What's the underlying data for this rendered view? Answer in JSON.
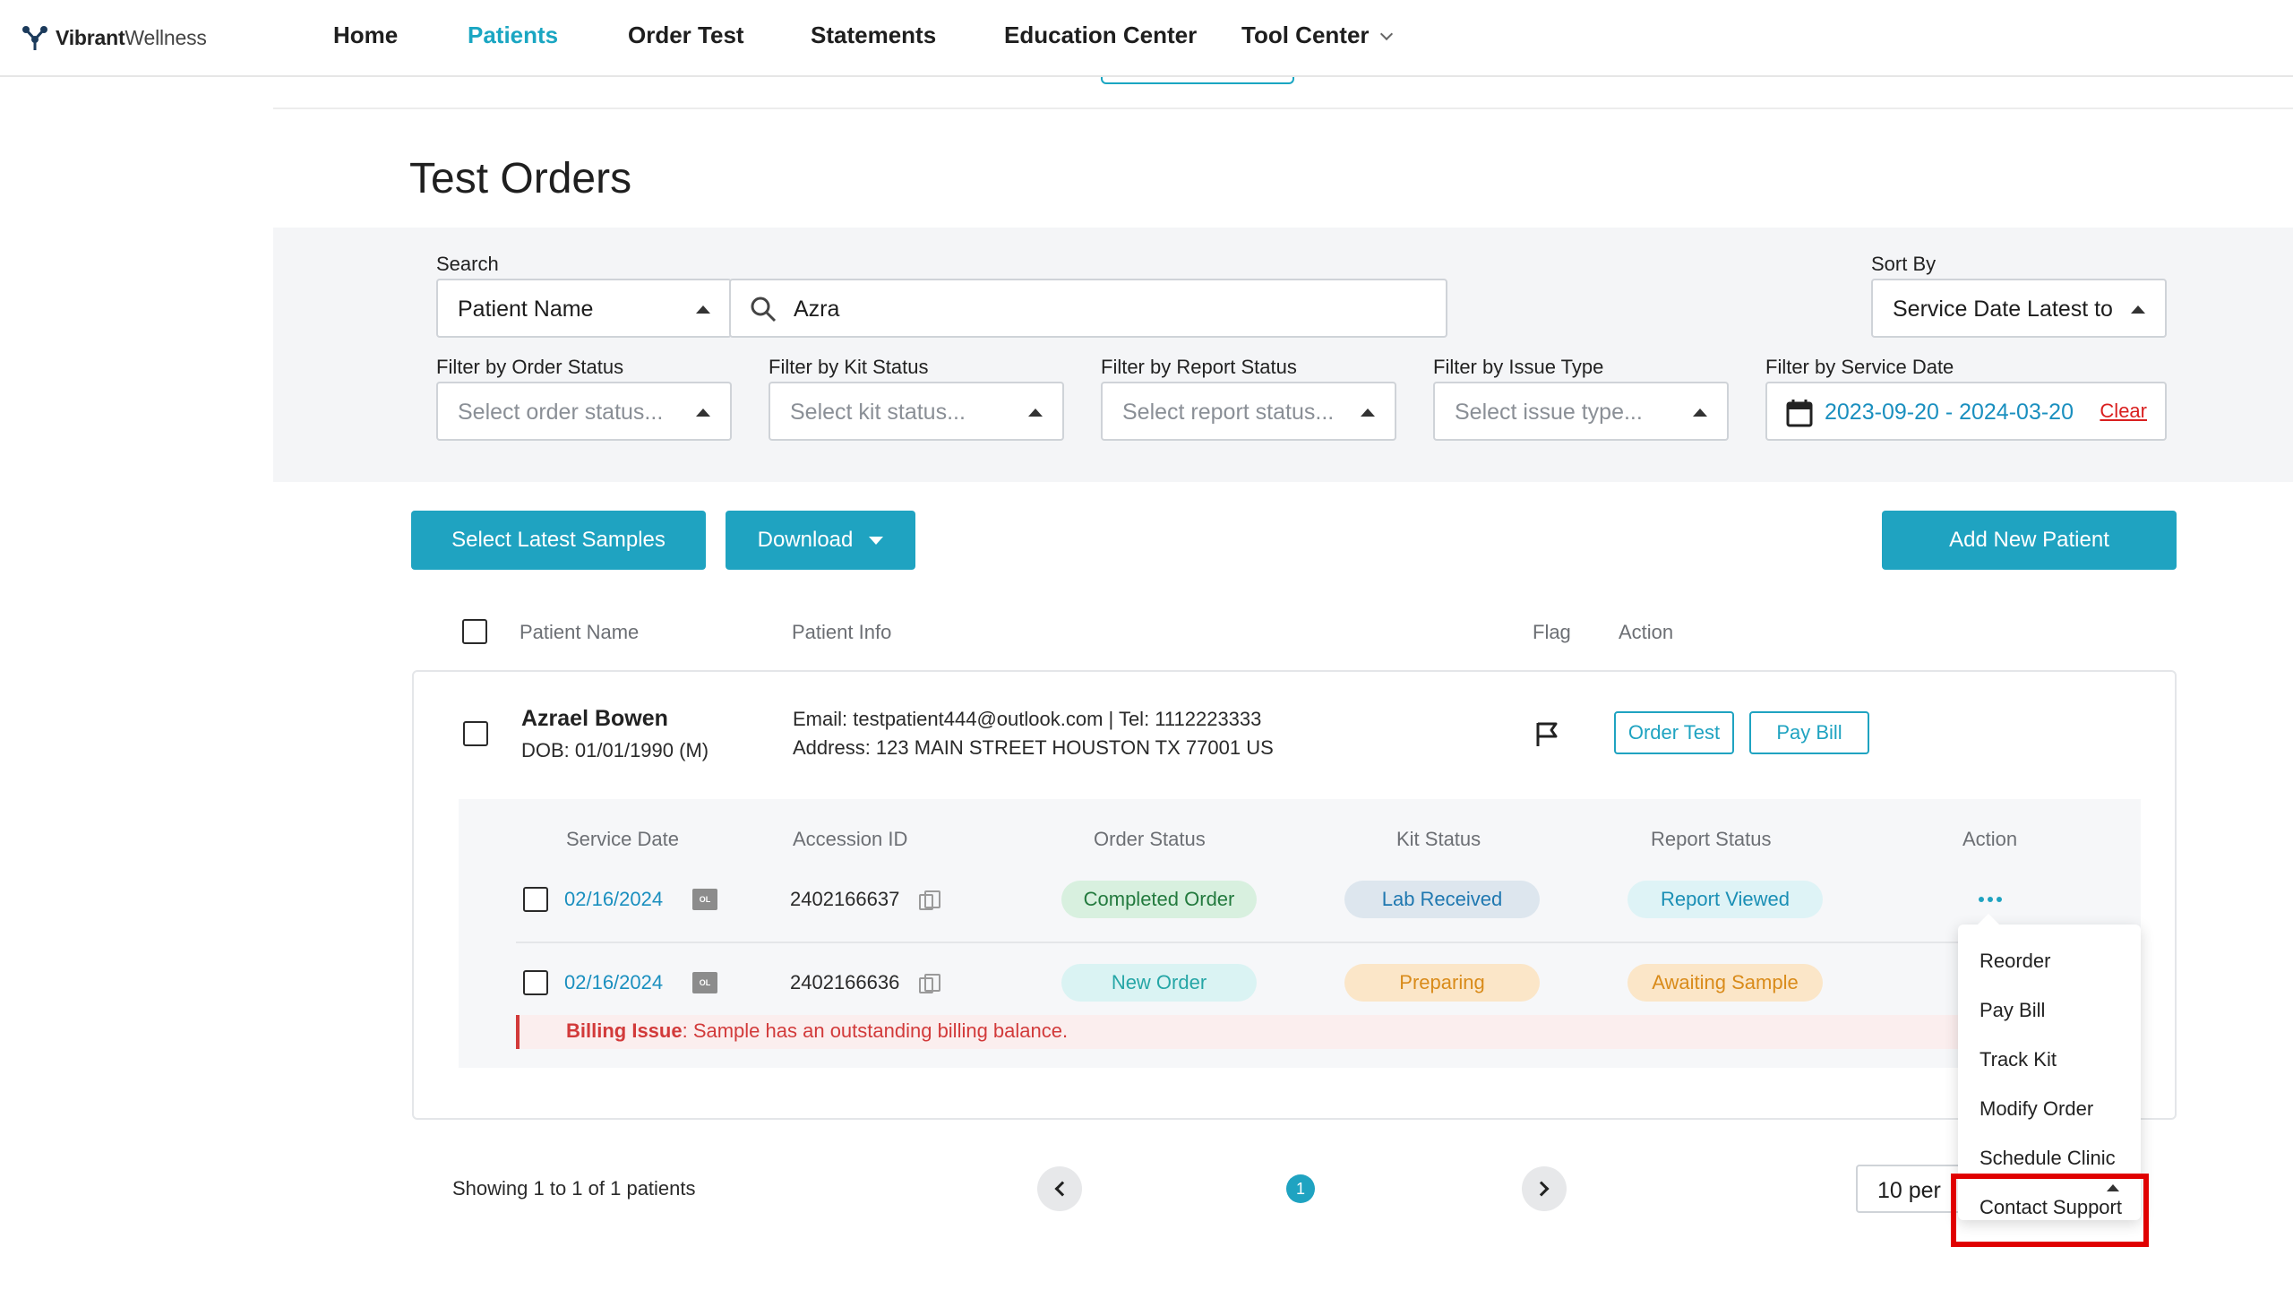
{
  "brand": {
    "bold": "Vibrant",
    "light": "Wellness"
  },
  "nav": {
    "home": "Home",
    "patients": "Patients",
    "order_test": "Order Test",
    "statements": "Statements",
    "education_center": "Education Center",
    "tool_center": "Tool Center"
  },
  "page_title": "Test Orders",
  "search": {
    "label": "Search",
    "field_type": "Patient Name",
    "query": "Azra"
  },
  "sort": {
    "label": "Sort By",
    "value": "Service Date Latest to O"
  },
  "filters": {
    "order_status": {
      "label": "Filter by Order Status",
      "placeholder": "Select order status..."
    },
    "kit_status": {
      "label": "Filter by Kit Status",
      "placeholder": "Select kit status..."
    },
    "report_status": {
      "label": "Filter by Report Status",
      "placeholder": "Select report status..."
    },
    "issue_type": {
      "label": "Filter by Issue Type",
      "placeholder": "Select issue type..."
    },
    "service_date": {
      "label": "Filter by Service Date",
      "value": "2023-09-20 - 2024-03-20",
      "clear": "Clear"
    }
  },
  "actions": {
    "select_latest": "Select Latest Samples",
    "download": "Download",
    "add_patient": "Add New Patient"
  },
  "table_headers": {
    "patient_name": "Patient Name",
    "patient_info": "Patient Info",
    "flag": "Flag",
    "action": "Action"
  },
  "patient": {
    "name": "Azrael Bowen",
    "dob": "DOB: 01/01/1990  (M)",
    "contact": "Email: testpatient444@outlook.com  |  Tel: 1112223333",
    "address": "Address: 123 MAIN STREET HOUSTON TX 77001 US",
    "order_test": "Order Test",
    "pay_bill": "Pay Bill"
  },
  "sample_headers": {
    "service_date": "Service Date",
    "accession_id": "Accession ID",
    "order_status": "Order Status",
    "kit_status": "Kit Status",
    "report_status": "Report Status",
    "action": "Action"
  },
  "samples": [
    {
      "date": "02/16/2024",
      "badge": "OL",
      "accession": "2402166637",
      "order_status": "Completed Order",
      "kit_status": "Lab Received",
      "report_status": "Report Viewed"
    },
    {
      "date": "02/16/2024",
      "badge": "OL",
      "accession": "2402166636",
      "order_status": "New Order",
      "kit_status": "Preparing",
      "report_status": "Awaiting Sample"
    }
  ],
  "billing_issue": {
    "label": "Billing Issue",
    "message": ": Sample has an outstanding billing balance."
  },
  "action_menu": [
    "Reorder",
    "Pay Bill",
    "Track Kit",
    "Modify Order",
    "Schedule Clinic",
    "Contact Support"
  ],
  "pagination": {
    "showing": "Showing 1 to 1 of 1 patients",
    "page": "1",
    "per_page": "10 per"
  },
  "colors": {
    "accent": "#1fa3c1",
    "completed_bg": "#d8f0df",
    "completed_fg": "#237a3e",
    "received_bg": "#dde6ee",
    "received_fg": "#1f78b0",
    "viewed_bg": "#def3f6",
    "viewed_fg": "#1a8fb5",
    "new_bg": "#daf3f3",
    "new_fg": "#25a6a6",
    "preparing_bg": "#fbe6c8",
    "preparing_fg": "#d98b1a",
    "awaiting_bg": "#fbe6c8",
    "awaiting_fg": "#d98b1a",
    "billing": "#d23a3a",
    "highlight": "#e00000"
  }
}
